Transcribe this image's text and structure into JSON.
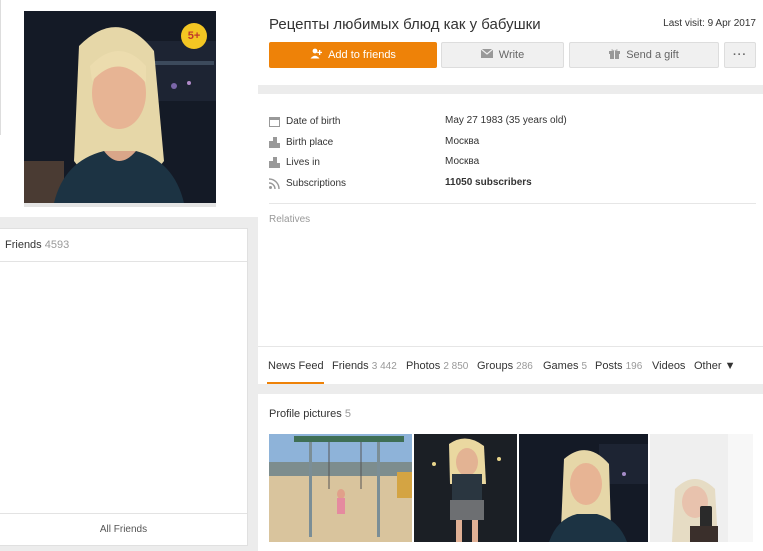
{
  "profile": {
    "name": "Рецепты любимых блюд как у бабушки",
    "last_visit": "Last visit: 9 Apr 2017",
    "age_badge": "5+"
  },
  "actions": {
    "add_friend": "Add to friends",
    "write": "Write",
    "gift": "Send a gift",
    "more": "···"
  },
  "info": [
    {
      "label": "Date of birth",
      "value": "May 27 1983 (35 years old)",
      "icon": "calendar-icon"
    },
    {
      "label": "Birth place",
      "value": "Москва",
      "icon": "city-icon"
    },
    {
      "label": "Lives in",
      "value": "Москва",
      "icon": "city-icon"
    },
    {
      "label": "Subscriptions",
      "value": "11050 subscribers",
      "icon": "rss-icon"
    }
  ],
  "relatives_label": "Relatives",
  "friends": {
    "label": "Friends",
    "count": "4593",
    "all_label": "All Friends"
  },
  "tabs": [
    {
      "label": "News Feed",
      "count": ""
    },
    {
      "label": "Friends",
      "count": "3 442"
    },
    {
      "label": "Photos",
      "count": "2 850"
    },
    {
      "label": "Groups",
      "count": "286"
    },
    {
      "label": "Games",
      "count": "5"
    },
    {
      "label": "Posts",
      "count": "196"
    },
    {
      "label": "Videos",
      "count": ""
    },
    {
      "label": "Other ▼",
      "count": ""
    }
  ],
  "photos": {
    "title": "Profile pictures",
    "count": "5"
  },
  "colors": {
    "accent": "#ee8208",
    "badge": "#f3c623"
  }
}
